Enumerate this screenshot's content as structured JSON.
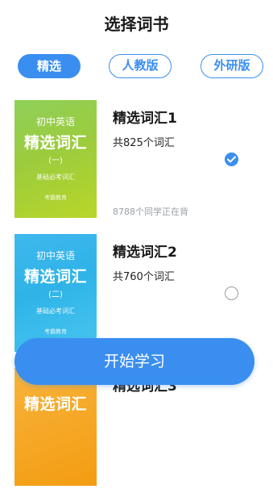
{
  "header": {
    "title": "选择词书"
  },
  "tabs": [
    {
      "label": "精选",
      "active": true
    },
    {
      "label": "人教版",
      "active": false
    },
    {
      "label": "外研版",
      "active": false
    }
  ],
  "books": [
    {
      "name": "精选词汇1",
      "count": "共825个词汇",
      "learners": "8788个同学正在背",
      "selected": true,
      "cover": {
        "line1": "初中英语",
        "line2": "精选词汇",
        "line3": "(一)",
        "line4": "基础必考词汇",
        "line5": "考霸教育"
      }
    },
    {
      "name": "精选词汇2",
      "count": "共760个词汇",
      "selected": false,
      "cover": {
        "line1": "初中英语",
        "line2": "精选词汇",
        "line3": "(二)",
        "line4": "基础必考词汇",
        "line5": "考霸教育"
      }
    },
    {
      "name": "精选词汇3",
      "cover": {
        "line2": "精选词汇"
      }
    }
  ],
  "footer": {
    "start_label": "开始学习"
  },
  "colors": {
    "accent": "#3a8ef0",
    "green_cover": "#9ccc3d",
    "blue_cover": "#2fb3e8",
    "orange_cover": "#f5a623"
  }
}
